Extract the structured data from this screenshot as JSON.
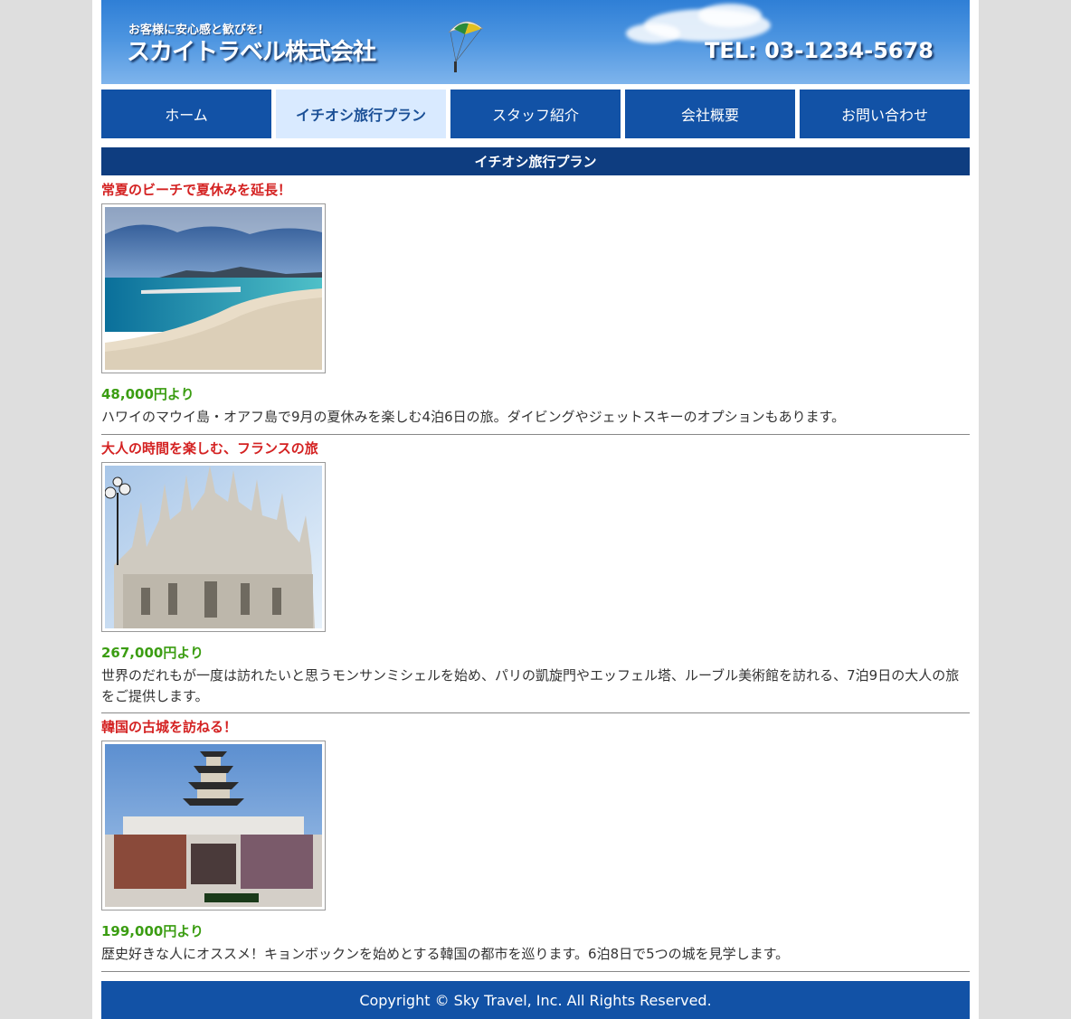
{
  "header": {
    "tagline": "お客様に安心感と歓びを!",
    "company": "スカイトラベル株式会社",
    "tel": "TEL: 03-1234-5678"
  },
  "nav": {
    "items": [
      {
        "label": "ホーム",
        "active": false
      },
      {
        "label": "イチオシ旅行プラン",
        "active": true
      },
      {
        "label": "スタッフ紹介",
        "active": false
      },
      {
        "label": "会社概要",
        "active": false
      },
      {
        "label": "お問い合わせ",
        "active": false
      }
    ]
  },
  "section_title": "イチオシ旅行プラン",
  "plans": [
    {
      "title": "常夏のビーチで夏休みを延長！",
      "price": "48,000円より",
      "description": "ハワイのマウイ島・オアフ島で9月の夏休みを楽しむ4泊6日の旅。ダイビングやジェットスキーのオプションもあります。"
    },
    {
      "title": "大人の時間を楽しむ、フランスの旅",
      "price": "267,000円より",
      "description": "世界のだれもが一度は訪れたいと思うモンサンミシェルを始め、パリの凱旋門やエッフェル塔、ルーブル美術館を訪れる、7泊9日の大人の旅をご提供します。"
    },
    {
      "title": "韓国の古城を訪ねる！",
      "price": "199,000円より",
      "description": "歴史好きな人にオススメ！キョンボックンを始めとする韓国の都市を巡ります。6泊8日で5つの城を見学します。"
    }
  ],
  "footer": "Copyright © Sky Travel, Inc. All Rights Reserved."
}
